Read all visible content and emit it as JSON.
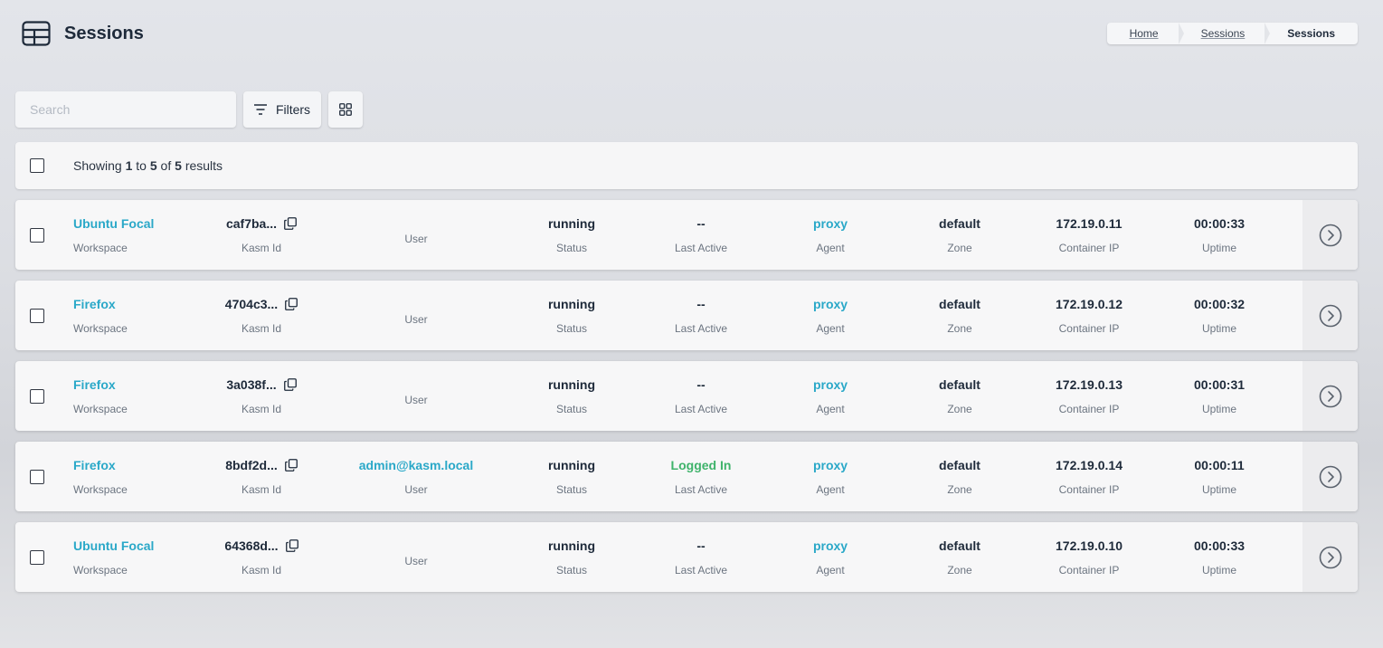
{
  "header": {
    "title": "Sessions",
    "icon": "table-icon"
  },
  "breadcrumb": {
    "items": [
      "Home",
      "Sessions"
    ],
    "current": "Sessions"
  },
  "toolbar": {
    "search_placeholder": "Search",
    "search_value": "",
    "filters_label": "Filters"
  },
  "summary": {
    "prefix": "Showing",
    "from": "1",
    "to_word": "to",
    "to": "5",
    "of_word": "of",
    "total": "5",
    "suffix": "results"
  },
  "labels": {
    "workspace": "Workspace",
    "kasm_id": "Kasm Id",
    "user": "User",
    "status": "Status",
    "last_active": "Last Active",
    "agent": "Agent",
    "zone": "Zone",
    "container_ip": "Container IP",
    "uptime": "Uptime"
  },
  "sessions": [
    {
      "workspace": "Ubuntu Focal",
      "kasm_id": "caf7ba...",
      "user": "",
      "status": "running",
      "last_active": "--",
      "agent": "proxy",
      "zone": "default",
      "container_ip": "172.19.0.11",
      "uptime": "00:00:33"
    },
    {
      "workspace": "Firefox",
      "kasm_id": "4704c3...",
      "user": "",
      "status": "running",
      "last_active": "--",
      "agent": "proxy",
      "zone": "default",
      "container_ip": "172.19.0.12",
      "uptime": "00:00:32"
    },
    {
      "workspace": "Firefox",
      "kasm_id": "3a038f...",
      "user": "",
      "status": "running",
      "last_active": "--",
      "agent": "proxy",
      "zone": "default",
      "container_ip": "172.19.0.13",
      "uptime": "00:00:31"
    },
    {
      "workspace": "Firefox",
      "kasm_id": "8bdf2d...",
      "user": "admin@kasm.local",
      "status": "running",
      "last_active": "Logged In",
      "agent": "proxy",
      "zone": "default",
      "container_ip": "172.19.0.14",
      "uptime": "00:00:11"
    },
    {
      "workspace": "Ubuntu Focal",
      "kasm_id": "64368d...",
      "user": "",
      "status": "running",
      "last_active": "--",
      "agent": "proxy",
      "zone": "default",
      "container_ip": "172.19.0.10",
      "uptime": "00:00:33"
    }
  ],
  "colors": {
    "link": "#2aa8c8",
    "logged_in": "#3fb36b",
    "text": "#1e2a3a"
  }
}
